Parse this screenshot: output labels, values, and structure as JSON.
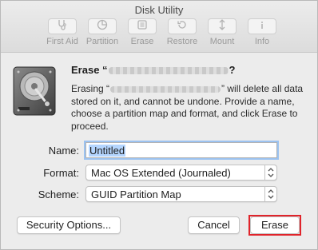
{
  "window": {
    "title": "Disk Utility"
  },
  "toolbar": {
    "items": [
      {
        "label": "First Aid",
        "icon": "stethoscope-icon"
      },
      {
        "label": "Partition",
        "icon": "partition-icon"
      },
      {
        "label": "Erase",
        "icon": "erase-icon"
      },
      {
        "label": "Restore",
        "icon": "restore-icon"
      },
      {
        "label": "Mount",
        "icon": "mount-icon"
      },
      {
        "label": "Info",
        "icon": "info-icon"
      }
    ]
  },
  "dialog": {
    "heading_prefix": "Erase “",
    "heading_suffix": "?",
    "desc_prefix": "Erasing “",
    "desc_suffix": "” will delete all data stored on it, and cannot be undone. Provide a name, choose a partition map and format, and click Erase to proceed.",
    "name_label": "Name:",
    "name_value": "Untitled",
    "format_label": "Format:",
    "format_value": "Mac OS Extended (Journaled)",
    "scheme_label": "Scheme:",
    "scheme_value": "GUID Partition Map",
    "security_button": "Security Options...",
    "cancel_button": "Cancel",
    "erase_button": "Erase"
  },
  "colors": {
    "highlight": "#e0242b",
    "focus": "#9cc3f1",
    "selection": "#b4d5fe"
  }
}
